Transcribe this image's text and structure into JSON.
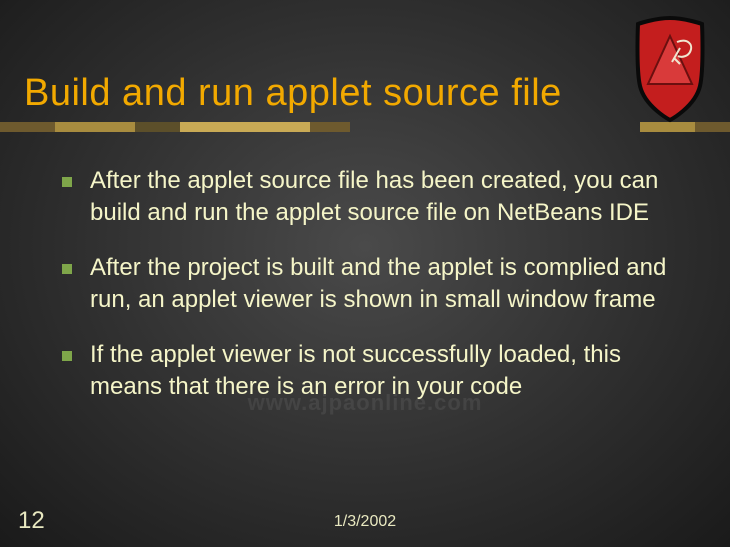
{
  "title": "Build and run applet source file",
  "bullets": {
    "b0": "After the applet source file has been created, you can build and run the applet source file on NetBeans IDE",
    "b1": "After the project is built and the applet is complied and run, an applet viewer is shown in small window frame",
    "b2": " If the applet viewer is not successfully loaded, this means that there is an error in your code"
  },
  "footer": {
    "page_number": "12",
    "date": "1/3/2002"
  },
  "watermark": "www.ajpaonline.com",
  "logo_name": "shield-logo"
}
